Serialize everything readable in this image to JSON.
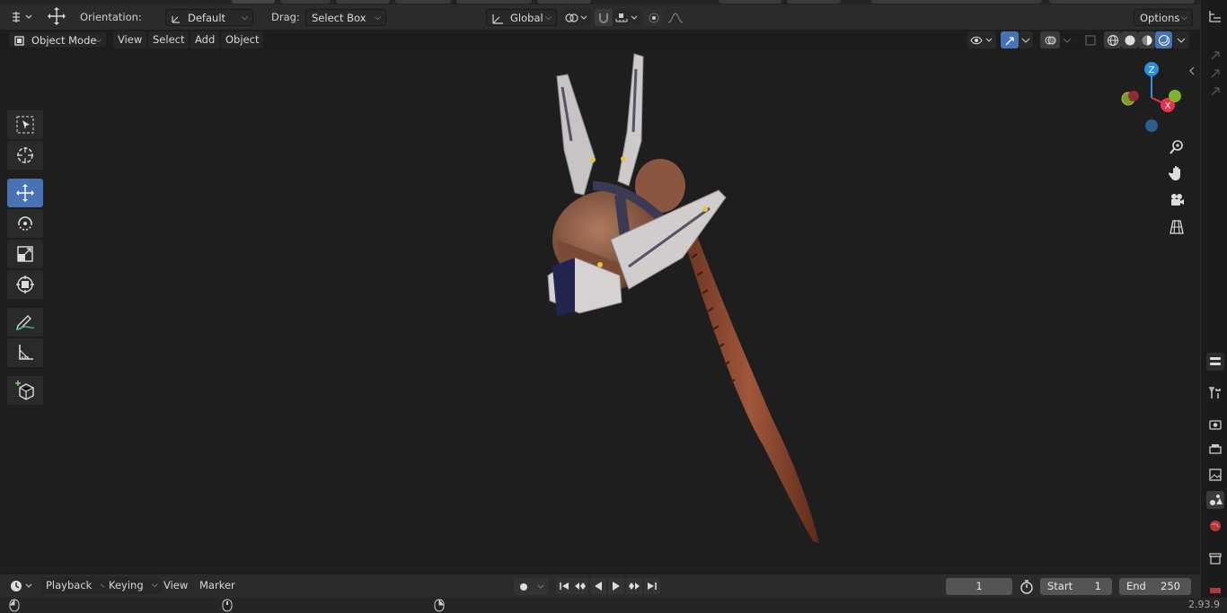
{
  "header": {
    "orientation_label": "Orientation:",
    "orientation_value": "Default",
    "drag_label": "Drag:",
    "drag_value": "Select Box",
    "transform_space": "Global",
    "options_label": "Options"
  },
  "viewport_header": {
    "mode": "Object Mode",
    "menus": [
      "View",
      "Select",
      "Add",
      "Object"
    ]
  },
  "toolbar": {
    "tools": [
      "select-box",
      "cursor",
      "move",
      "rotate",
      "scale",
      "transform",
      "annotate",
      "measure",
      "add-cube"
    ],
    "active": "move"
  },
  "gizmo": {
    "axes": [
      "Z",
      "X"
    ]
  },
  "navigation": [
    "zoom",
    "pan",
    "camera",
    "ortho-toggle"
  ],
  "timeline": {
    "menus": [
      "Playback",
      "Keying",
      "View",
      "Marker"
    ],
    "current_frame": "1",
    "start_label": "Start",
    "start_value": "1",
    "end_label": "End",
    "end_value": "250"
  },
  "status": {
    "version": "2.93.9"
  },
  "colors": {
    "accent": "#4772b3",
    "x_axis": "#e5334d",
    "y_axis": "#7fb32b",
    "z_axis": "#2c8fdf"
  }
}
